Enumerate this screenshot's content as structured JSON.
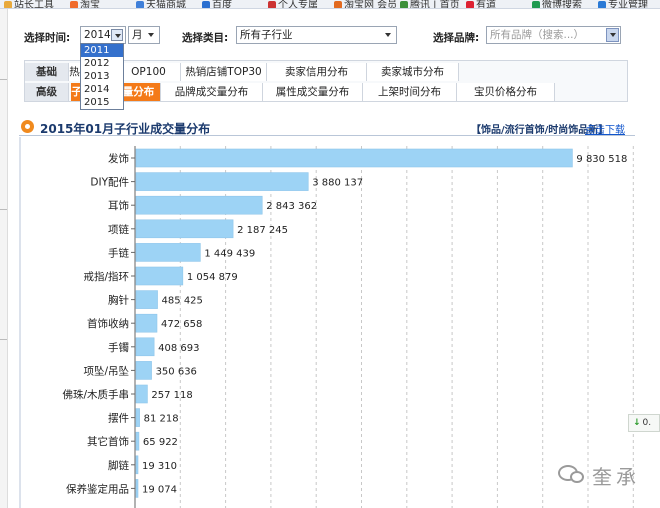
{
  "bookmarks": [
    "站长工具",
    "淘宝",
    "天猫商城",
    "百度",
    "个人专属",
    "淘宝网 会员",
    "腾讯 | 首页",
    "有道",
    "微博搜索",
    "专业管理"
  ],
  "filters": {
    "time_label": "选择时间:",
    "year_value": "2014",
    "month_value": "月",
    "category_label": "选择类目:",
    "category_value": "所有子行业",
    "brand_label": "选择品牌:",
    "brand_placeholder": "所有品牌（搜索...）"
  },
  "year_options": [
    "2011",
    "2012",
    "2013",
    "2014",
    "2015"
  ],
  "year_highlighted": "2011",
  "tabs": {
    "basic_label": "基础",
    "advanced_label": "高级",
    "basic": [
      "热",
      "OP100",
      "热销店铺TOP30",
      "卖家信用分布",
      "卖家城市分布"
    ],
    "advanced": [
      "子",
      "量分布",
      "品牌成交量分布",
      "属性成交量分布",
      "上架时间分布",
      "宝贝价格分布"
    ]
  },
  "chart_header": {
    "title": "2015年01月子行业成交量分布",
    "category": "【饰品/流行首饰/时尚饰品新】",
    "download": "点击下载"
  },
  "side_button": "0.",
  "watermark": "奎承",
  "colors": {
    "bar": "#9dd3f5",
    "accent": "#f47a18",
    "title": "#1b3a6d"
  },
  "icons": [
    "year-dropdown-arrow",
    "month-dropdown-arrow",
    "category-dropdown-arrow",
    "brand-dropdown-arrow",
    "chart-bullet-icon",
    "download-arrow-icon",
    "wechat-icon"
  ],
  "chart_data": {
    "type": "bar",
    "orientation": "horizontal",
    "title": "2015年01月子行业成交量分布",
    "categories": [
      "发饰",
      "DIY配件",
      "耳饰",
      "项链",
      "手链",
      "戒指/指环",
      "胸针",
      "首饰收纳",
      "手镯",
      "项坠/吊坠",
      "佛珠/木质手串",
      "摆件",
      "其它首饰",
      "脚链",
      "保养鉴定用品"
    ],
    "values": [
      9830518,
      3880137,
      2843362,
      2187245,
      1449439,
      1054879,
      485425,
      472658,
      408693,
      350636,
      257118,
      81218,
      65922,
      19310,
      19074
    ],
    "labels": [
      "9 830 518",
      "3 880 137",
      "2 843 362",
      "2 187 245",
      "1 449 439",
      "1 054 879",
      "485 425",
      "472 658",
      "408 693",
      "350 636",
      "257 118",
      "81 218",
      "65 922",
      "19 310",
      "19 074"
    ],
    "xlim": [
      0,
      10000000
    ],
    "grid": true,
    "legend": "none"
  }
}
